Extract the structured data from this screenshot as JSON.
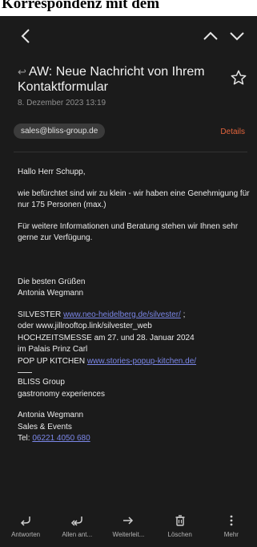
{
  "banner": {
    "text": "Korrespondenz mit dem"
  },
  "header": {
    "back_icon": "chevron-left-icon",
    "prev_icon": "chevron-up-icon",
    "next_icon": "chevron-down-icon"
  },
  "message": {
    "reply_indicator": "↩",
    "subject": "AW: Neue Nachricht von Ihrem Kontaktformular",
    "date": "8. Dezember 2023  13:19",
    "star_icon": "star-outline-icon",
    "sender": "sales@bliss-group.de",
    "details_label": "Details"
  },
  "body": {
    "greeting": "Hallo Herr Schupp,",
    "para1": "wie befürchtet sind wir zu klein - wir haben eine Genehmigung für nur 175 Personen (max.)",
    "para2": "Für weitere Informationen und Beratung stehen wir Ihnen sehr gerne zur Verfügung.",
    "closing1": "Die besten Grüßen",
    "closing2": "Antonia Wegmann",
    "silvester_prefix": "SILVESTER ",
    "silvester_link": "www.neo-heidelberg.de/silvester/",
    "silvester_suffix": " ;",
    "line_oder": "oder www.jillrooftop.link/silvester_web",
    "line_messe": "HOCHZEITSMESSE am 27. und 28. Januar 2024",
    "line_palais": "im Palais Prinz Carl",
    "popup_prefix": "POP UP KITCHEN ",
    "popup_link": "www.stories-popup-kitchen.de/",
    "company": "BLISS Group",
    "tagline": "gastronomy experiences",
    "sig_name": "Antonia Wegmann",
    "sig_role": "Sales & Events",
    "tel_label": "Tel: ",
    "tel_link": "06221 4050 680"
  },
  "bottom_nav": [
    {
      "label": "Antworten",
      "icon": "reply-icon"
    },
    {
      "label": "Allen ant...",
      "icon": "reply-all-icon"
    },
    {
      "label": "Weiterleit...",
      "icon": "forward-icon"
    },
    {
      "label": "Löschen",
      "icon": "trash-icon"
    },
    {
      "label": "Mehr",
      "icon": "more-vertical-icon"
    }
  ],
  "colors": {
    "background": "#1b1b1b",
    "accent": "#e2643c",
    "link": "#7b87e8"
  }
}
